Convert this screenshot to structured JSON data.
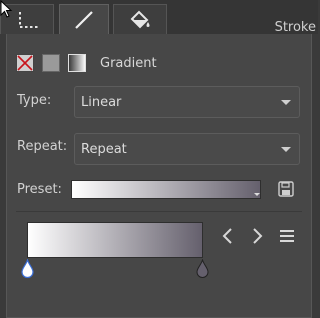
{
  "tabs": [
    {
      "name": "fill-tab",
      "icon": "dotted-corner-icon"
    },
    {
      "name": "stroke-tab",
      "icon": "line-icon",
      "active": true
    },
    {
      "name": "paint-bucket-tab",
      "icon": "paint-bucket-icon"
    }
  ],
  "panel_title": "Stroke",
  "fill_type": {
    "options": [
      "none",
      "flat-color",
      "gradient"
    ],
    "selected": "gradient",
    "label": "Gradient"
  },
  "type_field": {
    "label": "Type:",
    "value": "Linear"
  },
  "repeat_field": {
    "label": "Repeat:",
    "value": "Repeat"
  },
  "preset_field": {
    "label": "Preset:",
    "start_color": "#ffffff",
    "end_color": "#65606d"
  },
  "gradient_editor": {
    "stops": [
      {
        "color": "#ffffff",
        "position": 0
      },
      {
        "color": "#65606d",
        "position": 1
      }
    ]
  },
  "colors": {
    "background": "#3a3a3a",
    "panel": "#474747",
    "text": "#d2d2d2"
  }
}
